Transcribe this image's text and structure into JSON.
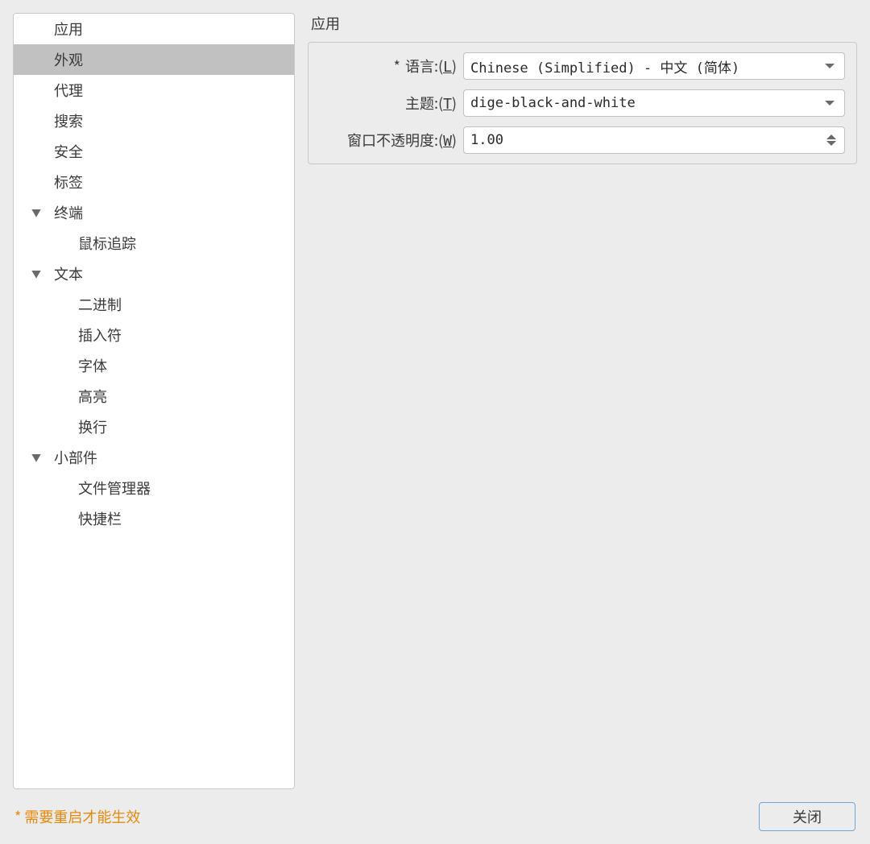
{
  "sidebar": {
    "items": [
      {
        "label": "应用",
        "level": 0,
        "expandable": false,
        "expanded": false,
        "selected": false
      },
      {
        "label": "外观",
        "level": 0,
        "expandable": false,
        "expanded": false,
        "selected": true
      },
      {
        "label": "代理",
        "level": 0,
        "expandable": false,
        "expanded": false,
        "selected": false
      },
      {
        "label": "搜索",
        "level": 0,
        "expandable": false,
        "expanded": false,
        "selected": false
      },
      {
        "label": "安全",
        "level": 0,
        "expandable": false,
        "expanded": false,
        "selected": false
      },
      {
        "label": "标签",
        "level": 0,
        "expandable": false,
        "expanded": false,
        "selected": false
      },
      {
        "label": "终端",
        "level": 0,
        "expandable": true,
        "expanded": true,
        "selected": false
      },
      {
        "label": "鼠标追踪",
        "level": 1,
        "expandable": false,
        "expanded": false,
        "selected": false
      },
      {
        "label": "文本",
        "level": 0,
        "expandable": true,
        "expanded": true,
        "selected": false
      },
      {
        "label": "二进制",
        "level": 1,
        "expandable": false,
        "expanded": false,
        "selected": false
      },
      {
        "label": "插入符",
        "level": 1,
        "expandable": false,
        "expanded": false,
        "selected": false
      },
      {
        "label": "字体",
        "level": 1,
        "expandable": false,
        "expanded": false,
        "selected": false
      },
      {
        "label": "高亮",
        "level": 1,
        "expandable": false,
        "expanded": false,
        "selected": false
      },
      {
        "label": "换行",
        "level": 1,
        "expandable": false,
        "expanded": false,
        "selected": false
      },
      {
        "label": "小部件",
        "level": 0,
        "expandable": true,
        "expanded": true,
        "selected": false
      },
      {
        "label": "文件管理器",
        "level": 1,
        "expandable": false,
        "expanded": false,
        "selected": false
      },
      {
        "label": "快捷栏",
        "level": 1,
        "expandable": false,
        "expanded": false,
        "selected": false
      }
    ]
  },
  "content": {
    "title": "应用",
    "rows": {
      "language": {
        "prefix": "* ",
        "label": "语言:(",
        "mnemonic": "L",
        "suffix": ")",
        "value": "Chinese (Simplified) - 中文 (简体)"
      },
      "theme": {
        "prefix": "",
        "label": "主题:(",
        "mnemonic": "T",
        "suffix": ")",
        "value": "dige-black-and-white"
      },
      "opacity": {
        "prefix": "",
        "label": "窗口不透明度:(",
        "mnemonic": "W",
        "suffix": ")",
        "value": "1.00"
      }
    }
  },
  "footer": {
    "restart_asterisk": "*",
    "restart_note": "需要重启才能生效",
    "close_label": "关闭"
  }
}
